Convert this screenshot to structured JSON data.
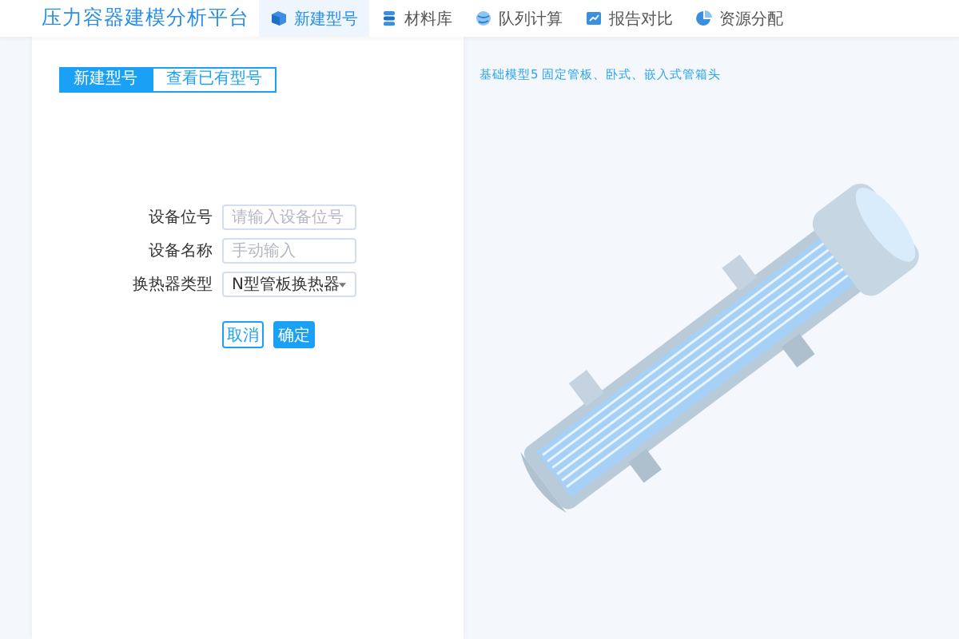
{
  "header": {
    "title": "压力容器建模分析平台",
    "nav": [
      {
        "label": "新建型号",
        "selected": true
      },
      {
        "label": "材料库",
        "selected": false
      },
      {
        "label": "队列计算",
        "selected": false
      },
      {
        "label": "报告对比",
        "selected": false
      },
      {
        "label": "资源分配",
        "selected": false
      }
    ]
  },
  "tabs": [
    {
      "label": "新建型号",
      "selected": true
    },
    {
      "label": "查看已有型号",
      "selected": false
    }
  ],
  "form": {
    "fields": [
      {
        "kind": "text",
        "label": "设备位号",
        "placeholder": "请输入设备位号"
      },
      {
        "kind": "text",
        "label": "设备名称",
        "placeholder": "手动输入"
      },
      {
        "kind": "select",
        "label": "换热器类型",
        "value": "N型管板换热器"
      }
    ],
    "buttons": [
      {
        "kind": "secondary",
        "label": "取消"
      },
      {
        "kind": "primary",
        "label": "确定"
      }
    ]
  },
  "viewer": {
    "caption": "基础模型5 固定管板、卧式、嵌入式管箱头"
  }
}
